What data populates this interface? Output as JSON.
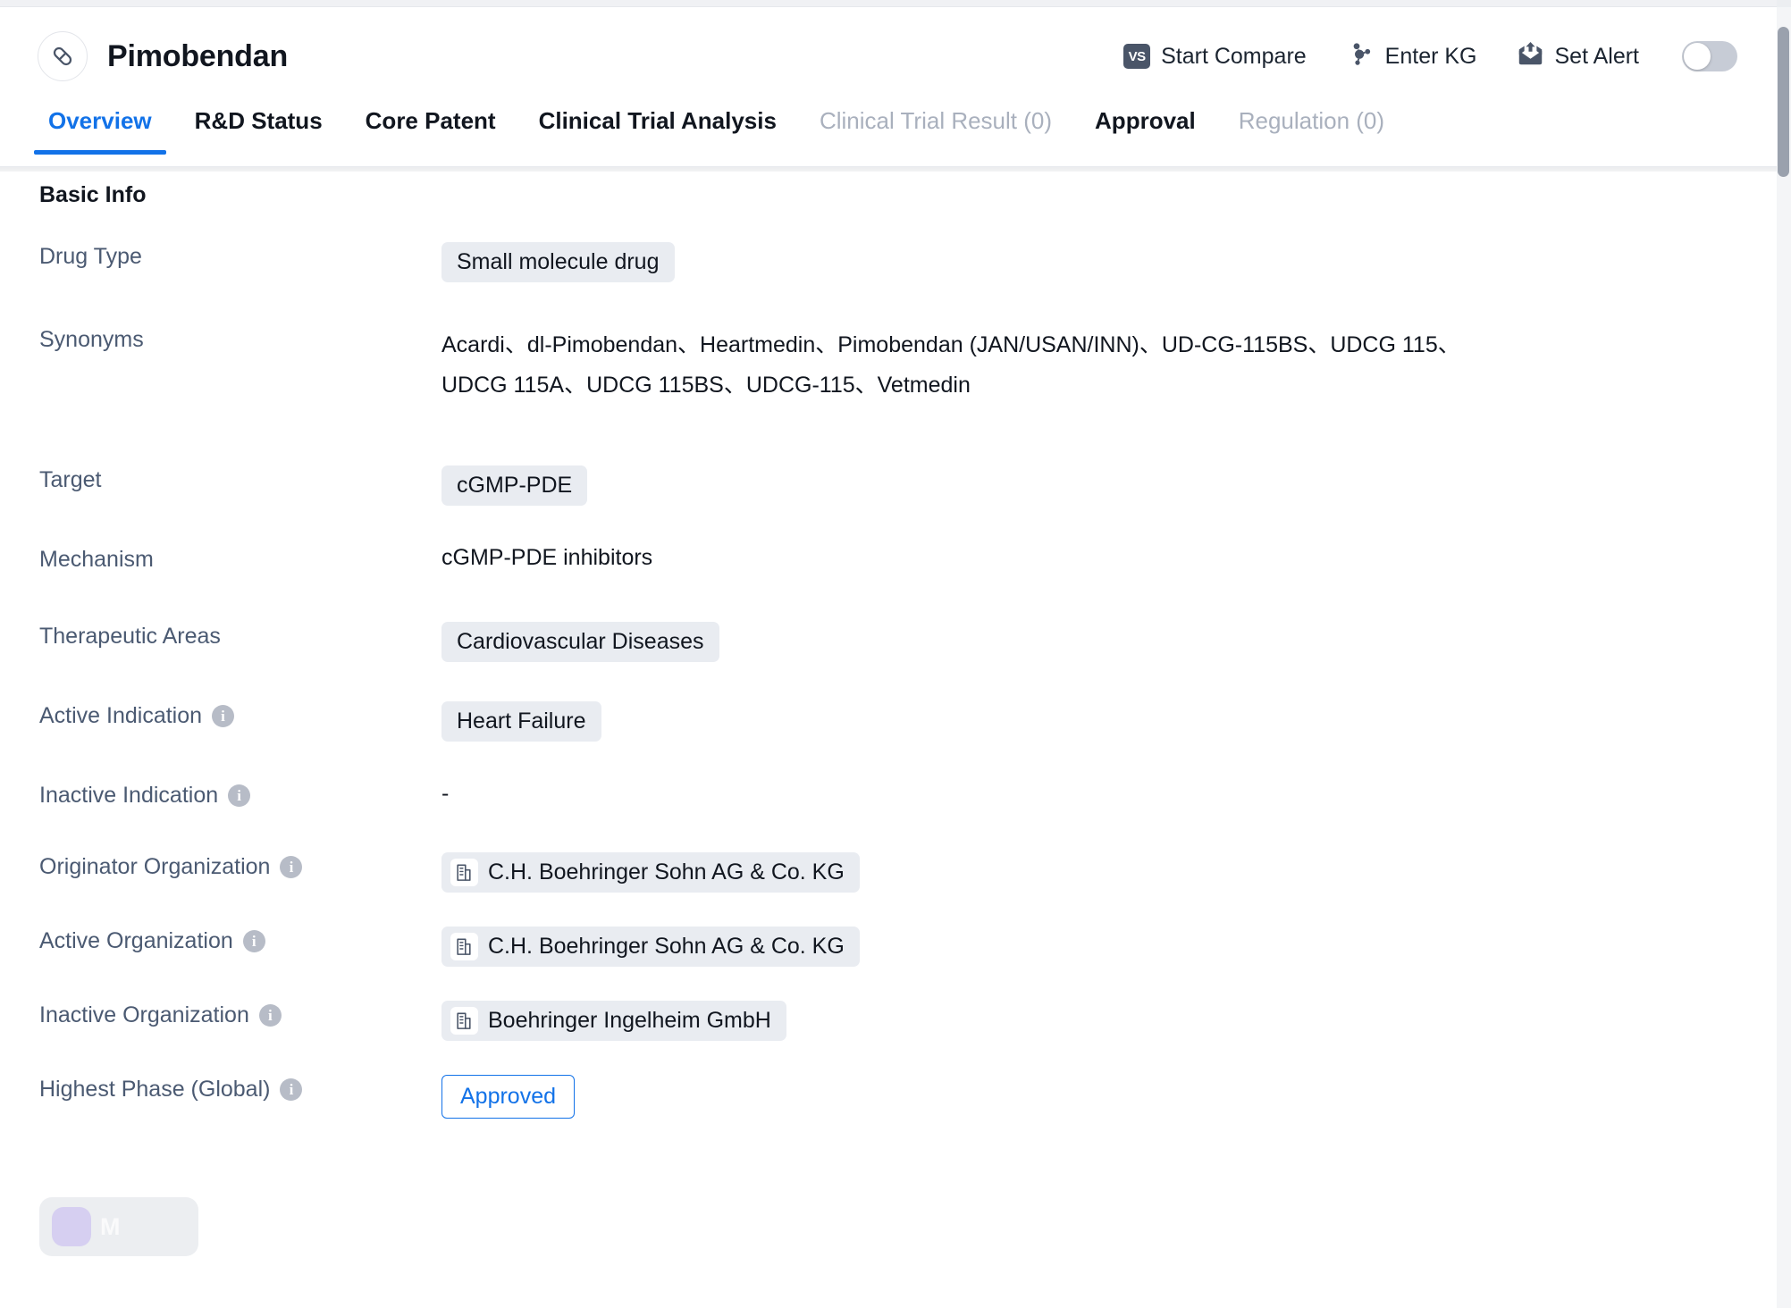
{
  "header": {
    "title": "Pimobendan",
    "drug_icon": "capsule-icon",
    "actions": [
      {
        "id": "start-compare",
        "label": "Start Compare",
        "icon": "vs-badge-icon",
        "badge_text": "VS"
      },
      {
        "id": "enter-kg",
        "label": "Enter KG",
        "icon": "knowledge-graph-icon"
      },
      {
        "id": "set-alert",
        "label": "Set Alert",
        "icon": "alert-envelope-icon"
      }
    ],
    "alert_toggle": {
      "state": "off"
    }
  },
  "tabs": [
    {
      "label": "Overview",
      "active": true,
      "disabled": false
    },
    {
      "label": "R&D Status",
      "active": false,
      "disabled": false
    },
    {
      "label": "Core Patent",
      "active": false,
      "disabled": false
    },
    {
      "label": "Clinical Trial Analysis",
      "active": false,
      "disabled": false
    },
    {
      "label": "Clinical Trial Result (0)",
      "active": false,
      "disabled": true
    },
    {
      "label": "Approval",
      "active": false,
      "disabled": false
    },
    {
      "label": "Regulation (0)",
      "active": false,
      "disabled": true
    }
  ],
  "basic_info": {
    "section_title": "Basic Info",
    "drug_type": {
      "label": "Drug Type",
      "value": "Small molecule drug"
    },
    "synonyms": {
      "label": "Synonyms",
      "line1": "Acardi、dl-Pimobendan、Heartmedin、Pimobendan (JAN/USAN/INN)、UD-CG-115BS、UDCG 115、",
      "line2": "UDCG 115A、UDCG 115BS、UDCG-115、Vetmedin"
    },
    "target": {
      "label": "Target",
      "value": "cGMP-PDE"
    },
    "mechanism": {
      "label": "Mechanism",
      "value": "cGMP-PDE inhibitors"
    },
    "therapeutic_areas": {
      "label": "Therapeutic Areas",
      "value": "Cardiovascular Diseases"
    },
    "active_indication": {
      "label": "Active Indication",
      "value": "Heart Failure",
      "has_info": true
    },
    "inactive_indication": {
      "label": "Inactive Indication",
      "value": "-",
      "has_info": true
    },
    "originator_organization": {
      "label": "Originator Organization",
      "value": "C.H. Boehringer Sohn AG & Co. KG",
      "has_info": true,
      "icon": "building-icon"
    },
    "active_organization": {
      "label": "Active Organization",
      "value": "C.H. Boehringer Sohn AG & Co. KG",
      "has_info": true,
      "icon": "building-icon"
    },
    "inactive_organization": {
      "label": "Inactive Organization",
      "value": "Boehringer Ingelheim GmbH",
      "has_info": true,
      "icon": "building-icon"
    },
    "highest_phase": {
      "label": "Highest Phase (Global)",
      "value": "Approved",
      "has_info": true
    }
  },
  "overlay_widget": {
    "text": "M"
  },
  "colors": {
    "accent": "#1272e8",
    "label_text": "#4b5a72",
    "chip_bg": "#e9ecf1",
    "disabled_tab": "#a9b0bd",
    "icon_slate": "#4a5568"
  }
}
